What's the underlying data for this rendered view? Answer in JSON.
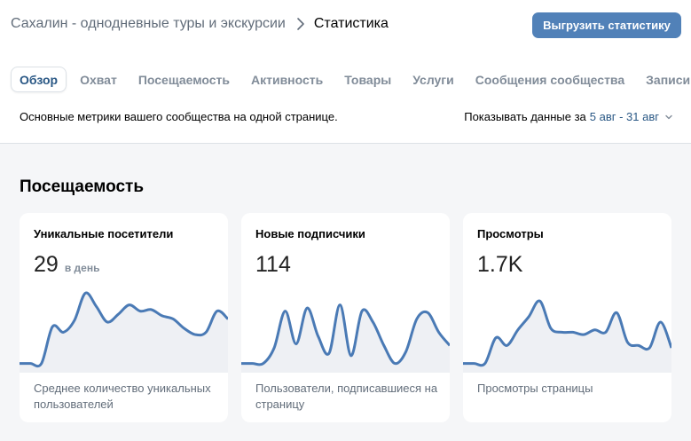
{
  "breadcrumb": {
    "community": "Сахалин - однодневные туры и экскурсии",
    "current": "Статистика"
  },
  "export_button": "Выгрузить статистику",
  "tabs": [
    {
      "label": "Обзор",
      "active": true
    },
    {
      "label": "Охват",
      "active": false
    },
    {
      "label": "Посещаемость",
      "active": false
    },
    {
      "label": "Активность",
      "active": false
    },
    {
      "label": "Товары",
      "active": false
    },
    {
      "label": "Услуги",
      "active": false
    },
    {
      "label": "Сообщения сообщества",
      "active": false
    },
    {
      "label": "Записи",
      "active": false
    }
  ],
  "subinfo": "Основные метрики вашего сообщества на одной странице.",
  "range": {
    "label": "Показывать данные за",
    "value": "5 авг - 31 авг"
  },
  "section_title": "Посещаемость",
  "cards": [
    {
      "title": "Уникальные посетители",
      "value": "29",
      "unit": "в день",
      "description": "Среднее количество уникальных пользователей",
      "trend": [
        0.05,
        0.05,
        0.05,
        0.52,
        0.45,
        0.6,
        0.95,
        0.78,
        0.58,
        0.68,
        0.8,
        0.72,
        0.74,
        0.66,
        0.62,
        0.5,
        0.42,
        0.45,
        0.72,
        0.62
      ]
    },
    {
      "title": "Новые подписчики",
      "value": "114",
      "unit": "",
      "description": "Пользователи, подписавшиеся на страницу",
      "trend": [
        0.05,
        0.05,
        0.05,
        0.25,
        0.72,
        0.3,
        0.76,
        0.4,
        0.18,
        0.8,
        0.15,
        0.72,
        0.58,
        0.28,
        0.05,
        0.2,
        0.62,
        0.7,
        0.45,
        0.28
      ]
    },
    {
      "title": "Просмотры",
      "value": "1.7K",
      "unit": "",
      "description": "Просмотры страницы",
      "trend": [
        0.05,
        0.05,
        0.05,
        0.38,
        0.28,
        0.48,
        0.65,
        0.85,
        0.5,
        0.45,
        0.45,
        0.42,
        0.48,
        0.45,
        0.7,
        0.32,
        0.28,
        0.25,
        0.58,
        0.25
      ]
    }
  ],
  "colors": {
    "accent": "#5181b8",
    "link": "#2a5885",
    "line": "#4a7ab5",
    "fill": "#eef0f4"
  }
}
